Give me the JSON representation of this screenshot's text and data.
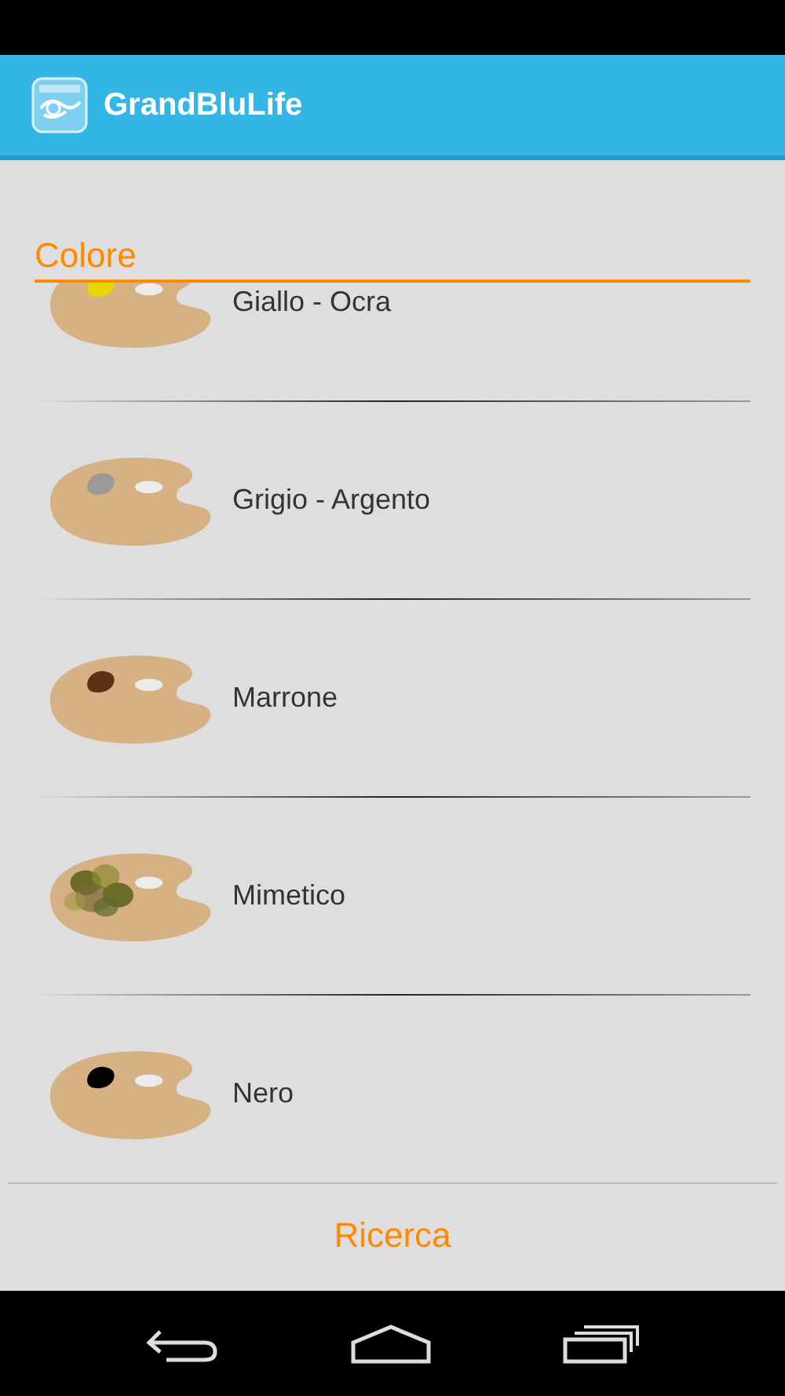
{
  "app_bar": {
    "title": "GrandBluLife"
  },
  "section": {
    "title": "Colore"
  },
  "items": [
    {
      "label": "Giallo - Ocra",
      "kind": "solid",
      "color": "#e8d400"
    },
    {
      "label": "Grigio - Argento",
      "kind": "solid",
      "color": "#9a9a9a"
    },
    {
      "label": "Marrone",
      "kind": "solid",
      "color": "#5a3214"
    },
    {
      "label": "Mimetico",
      "kind": "camo",
      "color": "#6b6b2a"
    },
    {
      "label": "Nero",
      "kind": "solid",
      "color": "#000000"
    }
  ],
  "search_button": {
    "label": "Ricerca"
  }
}
